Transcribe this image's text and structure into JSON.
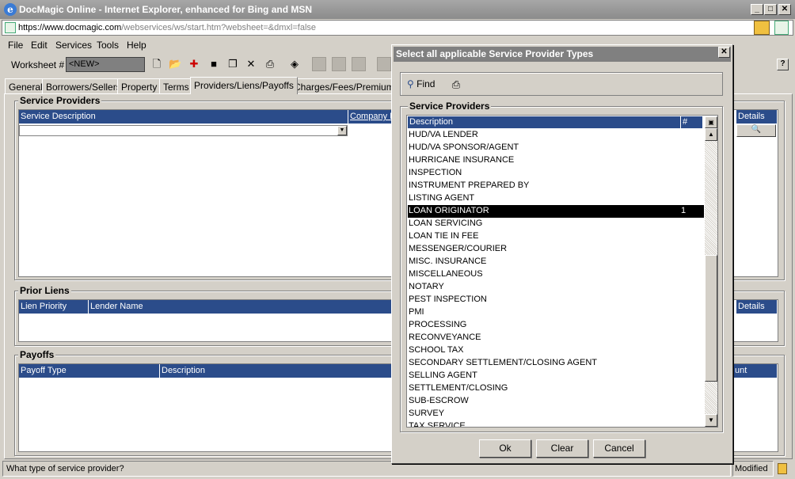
{
  "window": {
    "title": "DocMagic Online - Internet Explorer, enhanced for Bing and MSN",
    "address_scheme": "https://",
    "address_host": "www.docmagic.com",
    "address_path": "/webservices/ws/start.htm?websheet=&dmxl=false"
  },
  "menu": [
    "File",
    "Edit",
    "Services",
    "Tools",
    "Help"
  ],
  "toolbar": {
    "worksheet_label": "Worksheet #",
    "worksheet_value": "<NEW>"
  },
  "tabs": [
    "General",
    "Borrowers/Sellers",
    "Property",
    "Terms",
    "Providers/Liens/Payoffs",
    "Charges/Fees/Premiums"
  ],
  "service_providers": {
    "title": "Service Providers",
    "columns": [
      "Service Description",
      "Company N",
      "Details"
    ]
  },
  "prior_liens": {
    "title": "Prior Liens",
    "columns": [
      "Lien Priority",
      "Lender Name",
      "Details"
    ]
  },
  "payoffs": {
    "title": "Payoffs",
    "columns": [
      "Payoff Type",
      "Description",
      "unt"
    ]
  },
  "status": {
    "text": "What type of service provider?",
    "mode": "Modified"
  },
  "dialog": {
    "title": "Select all applicable Service Provider Types",
    "find_label": "Find",
    "group_title": "Service Providers",
    "columns": [
      "Description",
      "#"
    ],
    "items": [
      {
        "label": "HUD/VA LENDER",
        "count": ""
      },
      {
        "label": "HUD/VA SPONSOR/AGENT",
        "count": ""
      },
      {
        "label": "HURRICANE INSURANCE",
        "count": ""
      },
      {
        "label": "INSPECTION",
        "count": ""
      },
      {
        "label": "INSTRUMENT PREPARED BY",
        "count": ""
      },
      {
        "label": "LISTING AGENT",
        "count": ""
      },
      {
        "label": "LOAN ORIGINATOR",
        "count": "1"
      },
      {
        "label": "LOAN SERVICING",
        "count": ""
      },
      {
        "label": "LOAN TIE IN FEE",
        "count": ""
      },
      {
        "label": "MESSENGER/COURIER",
        "count": ""
      },
      {
        "label": "MISC. INSURANCE",
        "count": ""
      },
      {
        "label": "MISCELLANEOUS",
        "count": ""
      },
      {
        "label": "NOTARY",
        "count": ""
      },
      {
        "label": "PEST INSPECTION",
        "count": ""
      },
      {
        "label": "PMI",
        "count": ""
      },
      {
        "label": "PROCESSING",
        "count": ""
      },
      {
        "label": "RECONVEYANCE",
        "count": ""
      },
      {
        "label": "SCHOOL TAX",
        "count": ""
      },
      {
        "label": "SECONDARY SETTLEMENT/CLOSING AGENT",
        "count": ""
      },
      {
        "label": "SELLING AGENT",
        "count": ""
      },
      {
        "label": "SETTLEMENT/CLOSING",
        "count": ""
      },
      {
        "label": "SUB-ESCROW",
        "count": ""
      },
      {
        "label": "SURVEY",
        "count": ""
      },
      {
        "label": "TAX SERVICE",
        "count": ""
      }
    ],
    "selected_index": 6,
    "buttons": {
      "ok": "Ok",
      "clear": "Clear",
      "cancel": "Cancel"
    }
  }
}
